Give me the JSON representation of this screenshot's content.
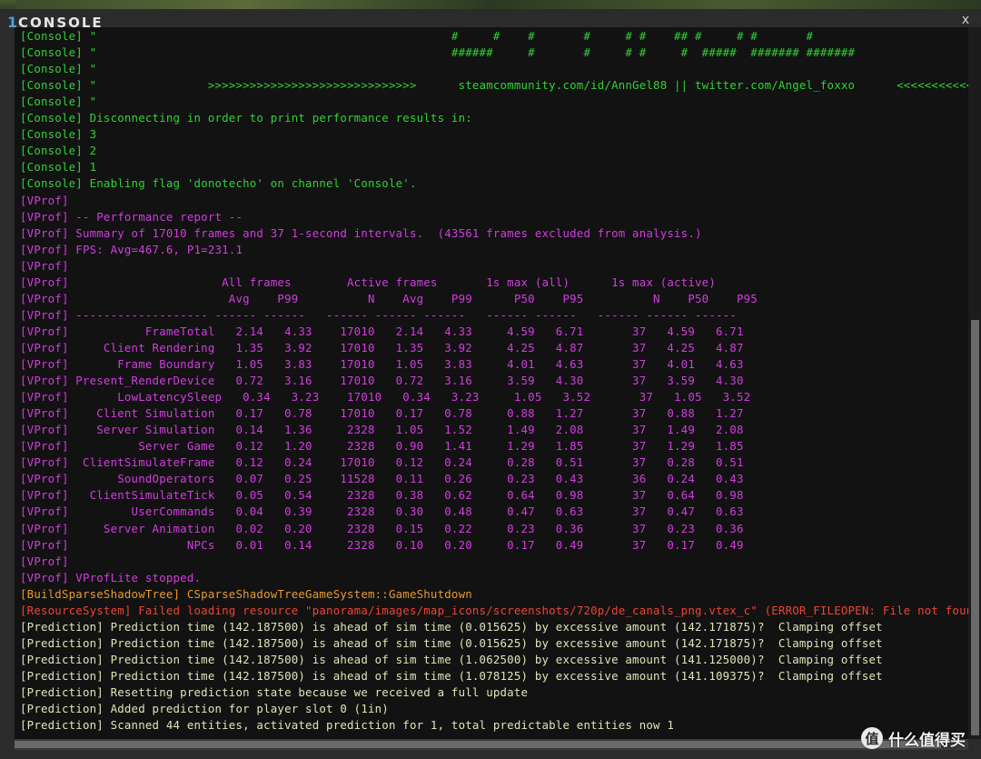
{
  "window": {
    "title_number": "1",
    "title": "CONSOLE",
    "close_label": "x"
  },
  "colors": {
    "console": "#31d135",
    "vprof": "#d23de0",
    "build": "#e89a2c",
    "resource": "#ef4433",
    "prediction": "#e4e3b8"
  },
  "log_lines": [
    {
      "text": "[Console] \"                                                   #     #    #       #     # #    ## #     # #       #",
      "color": "#31d135"
    },
    {
      "text": "[Console] \"                                                   ######     #       #     # #     #  #####  ####### #######",
      "color": "#31d135"
    },
    {
      "text": "[Console] \"",
      "color": "#31d135"
    },
    {
      "text": "[Console] \"                >>>>>>>>>>>>>>>>>>>>>>>>>>>>>>      steamcommunity.com/id/AnnGel88 || twitter.com/Angel_foxxo      <<<<<<<<<<<<<<<<<<<<<<<<<<<<<<",
      "color": "#31d135"
    },
    {
      "text": "[Console] \"",
      "color": "#31d135"
    },
    {
      "text": "[Console] Disconnecting in order to print performance results in:",
      "color": "#31d135"
    },
    {
      "text": "[Console] 3",
      "color": "#31d135"
    },
    {
      "text": "[Console] 2",
      "color": "#31d135"
    },
    {
      "text": "[Console] 1",
      "color": "#31d135"
    },
    {
      "text": "[Console] Enabling flag 'donotecho' on channel 'Console'.",
      "color": "#31d135"
    },
    {
      "text": "[VProf]",
      "color": "#d23de0"
    },
    {
      "text": "[VProf] -- Performance report --",
      "color": "#d23de0"
    },
    {
      "text": "[VProf] Summary of 17010 frames and 37 1-second intervals.  (43561 frames excluded from analysis.)",
      "color": "#d23de0"
    },
    {
      "text": "[VProf] FPS: Avg=467.6, P1=231.1",
      "color": "#d23de0"
    },
    {
      "text": "[VProf]",
      "color": "#d23de0"
    },
    {
      "text": "[VProf]                      All frames        Active frames       1s max (all)      1s max (active)",
      "color": "#d23de0"
    },
    {
      "text": "[VProf]                       Avg    P99          N    Avg    P99      P50    P95          N    P50    P95",
      "color": "#d23de0"
    },
    {
      "text": "[VProf] ------------------- ------ ------   ------ ------ ------   ------ ------   ------ ------ ------",
      "color": "#d23de0"
    },
    {
      "text": "[VProf]           FrameTotal   2.14   4.33    17010   2.14   4.33     4.59   6.71       37   4.59   6.71",
      "color": "#d23de0"
    },
    {
      "text": "[VProf]     Client Rendering   1.35   3.92    17010   1.35   3.92     4.25   4.87       37   4.25   4.87",
      "color": "#d23de0"
    },
    {
      "text": "[VProf]       Frame Boundary   1.05   3.83    17010   1.05   3.83     4.01   4.63       37   4.01   4.63",
      "color": "#d23de0"
    },
    {
      "text": "[VProf] Present_RenderDevice   0.72   3.16    17010   0.72   3.16     3.59   4.30       37   3.59   4.30",
      "color": "#d23de0"
    },
    {
      "text": "[VProf]       LowLatencySleep   0.34   3.23    17010   0.34   3.23     1.05   3.52       37   1.05   3.52",
      "color": "#d23de0"
    },
    {
      "text": "[VProf]    Client Simulation   0.17   0.78    17010   0.17   0.78     0.88   1.27       37   0.88   1.27",
      "color": "#d23de0"
    },
    {
      "text": "[VProf]    Server Simulation   0.14   1.36     2328   1.05   1.52     1.49   2.08       37   1.49   2.08",
      "color": "#d23de0"
    },
    {
      "text": "[VProf]          Server Game   0.12   1.20     2328   0.90   1.41     1.29   1.85       37   1.29   1.85",
      "color": "#d23de0"
    },
    {
      "text": "[VProf]  ClientSimulateFrame   0.12   0.24    17010   0.12   0.24     0.28   0.51       37   0.28   0.51",
      "color": "#d23de0"
    },
    {
      "text": "[VProf]       SoundOperators   0.07   0.25    11528   0.11   0.26     0.23   0.43       36   0.24   0.43",
      "color": "#d23de0"
    },
    {
      "text": "[VProf]   ClientSimulateTick   0.05   0.54     2328   0.38   0.62     0.64   0.98       37   0.64   0.98",
      "color": "#d23de0"
    },
    {
      "text": "[VProf]         UserCommands   0.04   0.39     2328   0.30   0.48     0.47   0.63       37   0.47   0.63",
      "color": "#d23de0"
    },
    {
      "text": "[VProf]     Server Animation   0.02   0.20     2328   0.15   0.22     0.23   0.36       37   0.23   0.36",
      "color": "#d23de0"
    },
    {
      "text": "[VProf]                 NPCs   0.01   0.14     2328   0.10   0.20     0.17   0.49       37   0.17   0.49",
      "color": "#d23de0"
    },
    {
      "text": "[VProf]",
      "color": "#d23de0"
    },
    {
      "text": "[VProf] VProfLite stopped.",
      "color": "#d23de0"
    },
    {
      "text": "[BuildSparseShadowTree] CSparseShadowTreeGameSystem::GameShutdown",
      "color": "#e89a2c"
    },
    {
      "text": "[ResourceSystem] Failed loading resource \"panorama/images/map_icons/screenshots/720p/de_canals_png.vtex_c\" (ERROR_FILEOPEN: File not found)",
      "color": "#ef4433"
    },
    {
      "text": "[Prediction] Prediction time (142.187500) is ahead of sim time (0.015625) by excessive amount (142.171875)?  Clamping offset",
      "color": "#e4e3b8"
    },
    {
      "text": "[Prediction] Prediction time (142.187500) is ahead of sim time (0.015625) by excessive amount (142.171875)?  Clamping offset",
      "color": "#e4e3b8"
    },
    {
      "text": "[Prediction] Prediction time (142.187500) is ahead of sim time (1.062500) by excessive amount (141.125000)?  Clamping offset",
      "color": "#e4e3b8"
    },
    {
      "text": "[Prediction] Prediction time (142.187500) is ahead of sim time (1.078125) by excessive amount (141.109375)?  Clamping offset",
      "color": "#e4e3b8"
    },
    {
      "text": "[Prediction] Resetting prediction state because we received a full update",
      "color": "#e4e3b8"
    },
    {
      "text": "[Prediction] Added prediction for player slot 0 (1in)",
      "color": "#e4e3b8"
    },
    {
      "text": "[Prediction] Scanned 44 entities, activated prediction for 1, total predictable entities now 1",
      "color": "#e4e3b8"
    }
  ],
  "watermark": {
    "logo_char": "值",
    "text": "什么值得买"
  }
}
